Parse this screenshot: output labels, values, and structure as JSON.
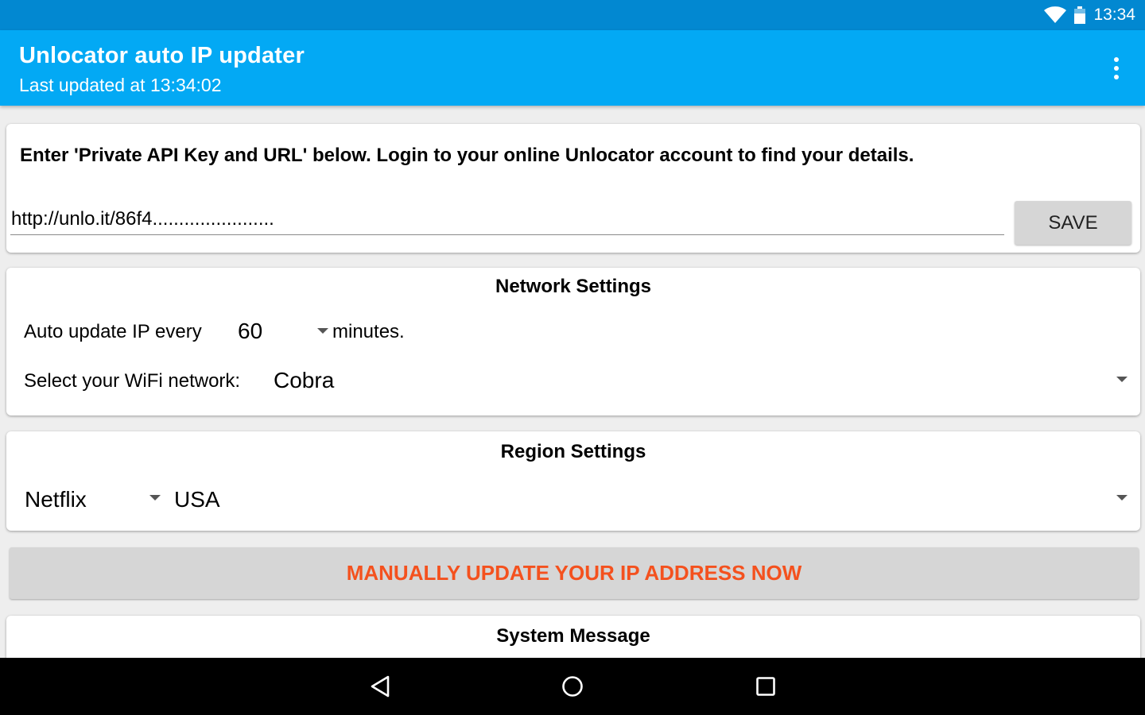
{
  "status_bar": {
    "time": "13:34",
    "icons": [
      "wifi-icon",
      "battery-icon"
    ]
  },
  "app_bar": {
    "title": "Unlocator auto IP updater",
    "subtitle": "Last updated at 13:34:02",
    "menu_icon": "overflow-menu-icon"
  },
  "api_card": {
    "instructions": "Enter 'Private API Key and URL' below. Login to your online Unlocator account to find your details.",
    "url_value": "http://unlo.it/86f4.......................",
    "save_label": "SAVE"
  },
  "network_card": {
    "title": "Network Settings",
    "auto_update_label": "Auto update IP every",
    "interval_value": "60",
    "minutes_label": "minutes.",
    "wifi_label": "Select your WiFi network:",
    "wifi_value": "Cobra"
  },
  "region_card": {
    "title": "Region Settings",
    "service_value": "Netflix",
    "country_value": "USA"
  },
  "manual_update": {
    "label": "MANUALLY UPDATE YOUR IP ADDRESS NOW"
  },
  "system_card": {
    "title": "System Message"
  },
  "nav_bar": {
    "icons": [
      "back-icon",
      "home-icon",
      "recents-icon"
    ]
  },
  "colors": {
    "status_bar": "#0288d1",
    "app_bar": "#03a9f4",
    "accent_text": "#f4511e",
    "button_bg": "#d6d6d6"
  }
}
